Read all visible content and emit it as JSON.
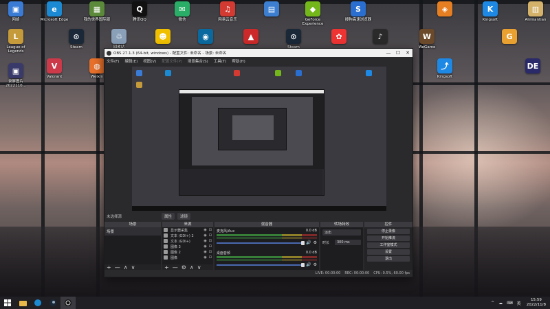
{
  "desktop": {
    "icons": [
      {
        "label": "网络",
        "color": "#3a7bd5",
        "glyph": "▣"
      },
      {
        "label": "Microsoft Edge",
        "color": "#1b8ad3",
        "glyph": "e"
      },
      {
        "label": "我的世界国际版",
        "color": "#5a8a3a",
        "glyph": "▦"
      },
      {
        "label": "腾讯QQ",
        "color": "#111111",
        "glyph": "Q"
      },
      {
        "label": "微信",
        "color": "#2aae67",
        "glyph": "✉"
      },
      {
        "label": "网易云音乐",
        "color": "#d33a31",
        "glyph": "♫"
      },
      {
        "label": "",
        "color": "#3c7fd0",
        "glyph": "▤"
      },
      {
        "label": "GeForce Experience",
        "color": "#74b71b",
        "glyph": "◆"
      },
      {
        "label": "搜狗高速浏览器",
        "color": "#2a6fd0",
        "glyph": "S"
      },
      {
        "label": "",
        "color": "#e67e22",
        "glyph": "◈"
      },
      {
        "label": "Kingsoft",
        "color": "#1e88e5",
        "glyph": "K"
      },
      {
        "label": "Alimiantian",
        "color": "#d4b26a",
        "glyph": "▥"
      },
      {
        "label": "League of Legends",
        "color": "#c49a3a",
        "glyph": "L"
      },
      {
        "label": "Steam",
        "color": "#1b2838",
        "glyph": "⊙"
      },
      {
        "label": "回收站",
        "color": "#8aa0b8",
        "glyph": "♲"
      },
      {
        "label": "",
        "color": "#f0c000",
        "glyph": "☻"
      },
      {
        "label": "",
        "color": "#0a6aa0",
        "glyph": "◉"
      },
      {
        "label": "",
        "color": "#cc2a2a",
        "glyph": "▲"
      },
      {
        "label": "Steam",
        "color": "#1b2838",
        "glyph": "⊙"
      },
      {
        "label": "",
        "color": "#e33",
        "glyph": "✿"
      },
      {
        "label": "",
        "color": "#2a2a2a",
        "glyph": "♪"
      },
      {
        "label": "WeGame",
        "color": "#6a4a2a",
        "glyph": "W"
      },
      {
        "label": "",
        "color": "#e8a030",
        "glyph": "G"
      },
      {
        "label": "录屏图片 2022110...",
        "color": "#3a3a6a",
        "glyph": "▣"
      },
      {
        "label": "Valorant",
        "color": "#cc3a4a",
        "glyph": "V"
      },
      {
        "label": "Weixin",
        "color": "#e8702a",
        "glyph": "◍"
      },
      {
        "label": "Kingsoft",
        "color": "#1e88e5",
        "glyph": "⤴"
      },
      {
        "label": "",
        "color": "#2a2a6a",
        "glyph": "DE"
      }
    ]
  },
  "obs": {
    "title": "OBS 27.1.3 (64-bit, windows) - 配置文件: 未命名 - 场景: 未命名",
    "window_buttons": {
      "min": "—",
      "max": "☐",
      "close": "✕"
    },
    "menu": [
      "文件(F)",
      "编辑(E)",
      "视图(V)",
      "配置文件(P)",
      "场景集合(S)",
      "工具(T)",
      "帮助(H)"
    ],
    "scene_state": "未选择源",
    "preview_chips": [
      "属性",
      "滤镜"
    ],
    "docks": {
      "scenes": {
        "title": "场景",
        "items": [
          "场景"
        ]
      },
      "sources": {
        "title": "来源",
        "items": [
          "显示器采集",
          "文本 (GDI+) 2",
          "文本 (GDI+)",
          "图像 3",
          "图像 2",
          "图像"
        ]
      },
      "mixer": {
        "title": "混音器",
        "channels": [
          {
            "name": "麦克风/Aux",
            "db": "0.0 dB"
          },
          {
            "name": "桌面音频",
            "db": "0.0 dB"
          }
        ]
      },
      "transitions": {
        "title": "转场特效",
        "type_value": "淡出",
        "duration_label": "时长",
        "duration_value": "300 ms"
      },
      "controls": {
        "title": "控件",
        "buttons": [
          "停止录像",
          "开始推流",
          "工作室模式",
          "设置",
          "退出"
        ]
      }
    },
    "footer_symbols": {
      "add": "+",
      "remove": "—",
      "up": "∧",
      "down": "∨",
      "gear": "⚙"
    },
    "statusbar": [
      "LIVE: 00:00:00",
      "REC: 00:00:00",
      "CPU: 0.5%, 60.00 fps"
    ]
  },
  "taskbar": {
    "items": [
      "start-icon",
      "search-icon",
      "edge-icon",
      "steam-icon",
      "obs-icon"
    ],
    "tray": [
      "^",
      "☁",
      "⌨",
      "英"
    ],
    "time": "15:59",
    "date": "2022/11/8"
  }
}
